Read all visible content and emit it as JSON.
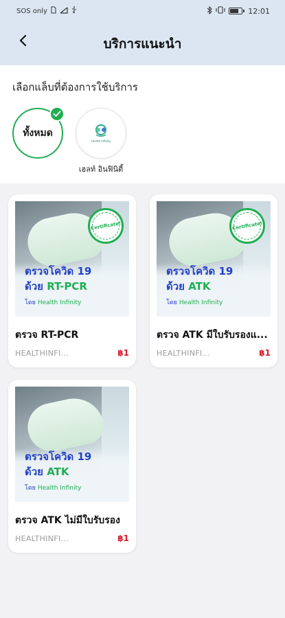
{
  "status_bar": {
    "left_text": "SOS only",
    "time": "12:01"
  },
  "header": {
    "title": "บริการแนะนำ",
    "back_icon": "chevron-left-icon"
  },
  "filter": {
    "label": "เลือกแล็บที่ต้องการใช้บริการ",
    "chips": [
      {
        "label": "ทั้งหมด",
        "selected": true
      },
      {
        "caption": "เฮลท์ อินฟินิตี้",
        "logo_text": "Health Infinity",
        "selected": false
      }
    ]
  },
  "products": [
    {
      "title": "ตรวจ RT-PCR",
      "lab": "HEALTHINFI...",
      "price": "฿1",
      "image": {
        "line1": "ตรวจโควิด 19",
        "line2_prefix": "ด้วย",
        "line2_accent": "RT-PCR",
        "line3_prefix": "โดย",
        "line3_accent": "Health Infinity",
        "badge": "Certificate!"
      }
    },
    {
      "title": "ตรวจ ATK มีใบรับรองแ...",
      "lab": "HEALTHINFI...",
      "price": "฿1",
      "image": {
        "line1": "ตรวจโควิด 19",
        "line2_prefix": "ด้วย",
        "line2_accent": "ATK",
        "line3_prefix": "โดย",
        "line3_accent": "Health Infinity",
        "badge": "Certificate!"
      }
    },
    {
      "title": "ตรวจ ATK ไม่มีใบรับรอง",
      "lab": "HEALTHINFI...",
      "price": "฿1",
      "image": {
        "line1": "ตรวจโควิด 19",
        "line2_prefix": "ด้วย",
        "line2_accent": "ATK",
        "line3_prefix": "โดย",
        "line3_accent": "Health Infinity",
        "badge": null
      }
    }
  ],
  "colors": {
    "header_bg": "#dbe6f2",
    "accent_green": "#1fae52",
    "price_red": "#d0202f",
    "image_text_blue": "#2340c8"
  }
}
